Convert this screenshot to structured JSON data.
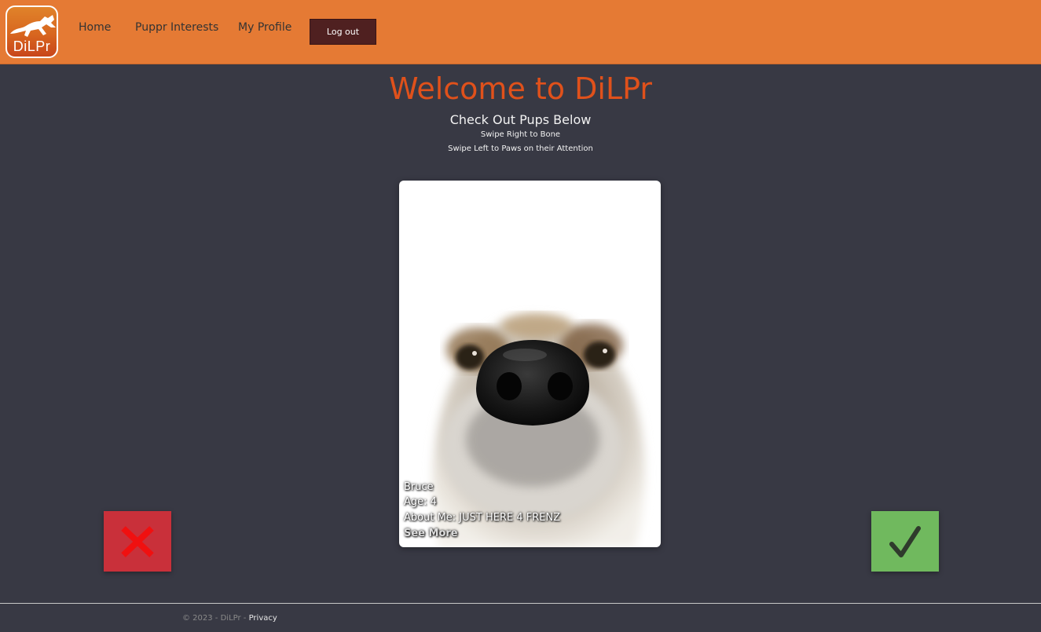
{
  "header": {
    "logo_text": "DiLPr",
    "nav": {
      "home": "Home",
      "interests": "Puppr Interests",
      "profile": "My Profile"
    },
    "logout_label": "Log out"
  },
  "main": {
    "title": "Welcome to DiLPr",
    "subtitle": "Check Out Pups Below",
    "hint_right": "Swipe Right to Bone",
    "hint_left": "Swipe Left to Paws on their Attention"
  },
  "card": {
    "name": "Bruce",
    "age": "Age: 4",
    "about": "About Me: JUST HERE 4 FRENZ",
    "see_more": "See More"
  },
  "actions": {
    "reject_icon": "x-icon",
    "accept_icon": "checkmark-icon"
  },
  "footer": {
    "copyright": "© 2023 - DiLPr - ",
    "privacy": "Privacy"
  },
  "colors": {
    "header_bg": "#e57a34",
    "page_bg": "#383944",
    "title": "#e0511b",
    "logout_bg": "#4f2020",
    "reject_bg": "#c9303a",
    "accept_bg": "#70b95e"
  }
}
